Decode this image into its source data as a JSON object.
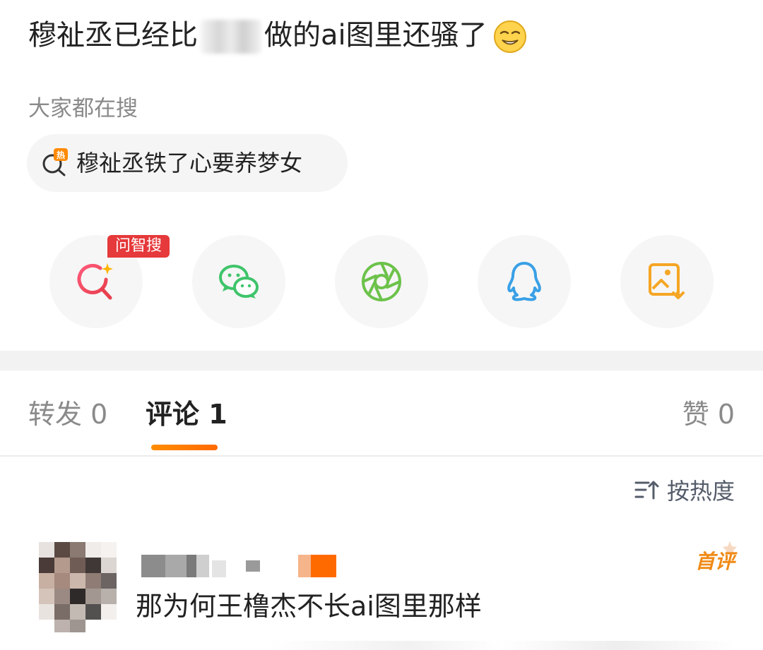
{
  "post": {
    "title_before": "穆祉丞已经比",
    "title_after": "做的ai图里还骚了",
    "emoji": "smirk-face-emoji"
  },
  "trending": {
    "label": "大家都在搜",
    "hot_badge": "热",
    "query": "穆祉丞铁了心要养梦女"
  },
  "share": {
    "badge": "问智搜",
    "buttons": [
      "ai-search-icon",
      "wechat-icon",
      "moments-icon",
      "qq-icon",
      "save-image-icon"
    ]
  },
  "tabs": {
    "repost": "转发 0",
    "comment": "评论 1",
    "like": "赞 0"
  },
  "sort": {
    "label": "按热度"
  },
  "comment": {
    "first_badge": "首评",
    "text": "那为何王橹杰不长ai图里那样"
  },
  "colors": {
    "accent_orange": "#ff7a00",
    "badge_red": "#e6393b",
    "wechat_green": "#3fc46a",
    "moments_green": "#6cc24a",
    "qq_blue": "#39a0e6",
    "save_orange": "#f5a623",
    "search_red": "#e84a5f"
  }
}
